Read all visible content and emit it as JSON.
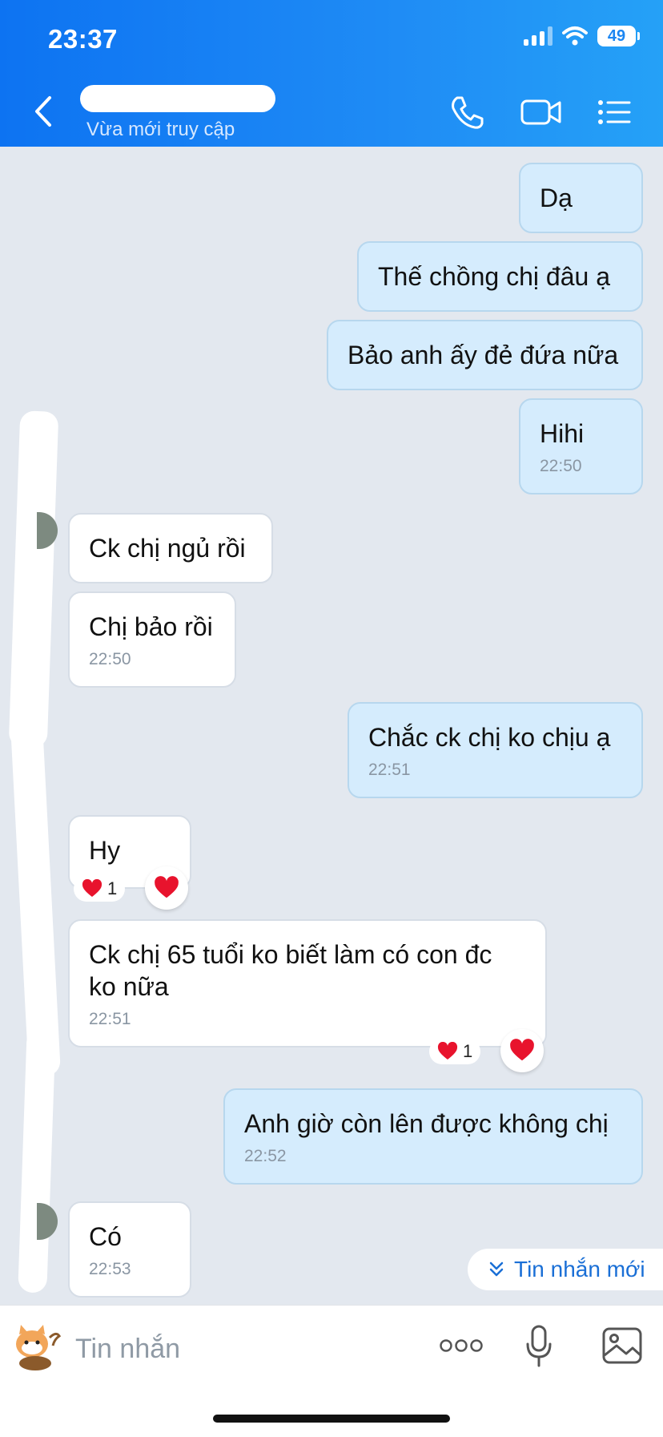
{
  "status_bar": {
    "time": "23:37",
    "battery": "49"
  },
  "header": {
    "contact_status": "Vừa mới truy cập"
  },
  "messages": [
    {
      "text": "Dạ",
      "time": ""
    },
    {
      "text": "Thế chồng chị đâu ạ",
      "time": ""
    },
    {
      "text": "Bảo anh ấy đẻ đứa nữa",
      "time": ""
    },
    {
      "text": "Hihi",
      "time": "22:50"
    },
    {
      "text": "Ck chị ngủ rồi",
      "time": ""
    },
    {
      "text": "Chị bảo rồi",
      "time": "22:50"
    },
    {
      "text": "Chắc ck chị ko chịu ạ",
      "time": "22:51"
    },
    {
      "text": "Hy",
      "time": "",
      "reaction_count": "1"
    },
    {
      "text": "Ck chị 65 tuổi ko biết làm có con đc ko nữa",
      "time": "22:51",
      "reaction_count": "1"
    },
    {
      "text": "Anh giờ còn lên được không chị",
      "time": "22:52"
    },
    {
      "text": "Có",
      "time": "22:53"
    }
  ],
  "new_messages_button": {
    "label": "Tin nhắn mới"
  },
  "composer": {
    "placeholder": "Tin nhắn"
  },
  "colors": {
    "header_blue": "#0d73f2",
    "outgoing_bubble": "#d5ecfd",
    "incoming_bubble": "#ffffff",
    "chat_background": "#e3e8ef",
    "link_blue": "#1a6fd6",
    "heart_red": "#e8132d"
  },
  "icons": [
    "chevron-left-icon",
    "phone-icon",
    "video-camera-icon",
    "list-menu-icon",
    "heart-icon",
    "double-chevron-down-icon",
    "sticker-icon",
    "more-dots-icon",
    "microphone-icon",
    "image-icon"
  ]
}
